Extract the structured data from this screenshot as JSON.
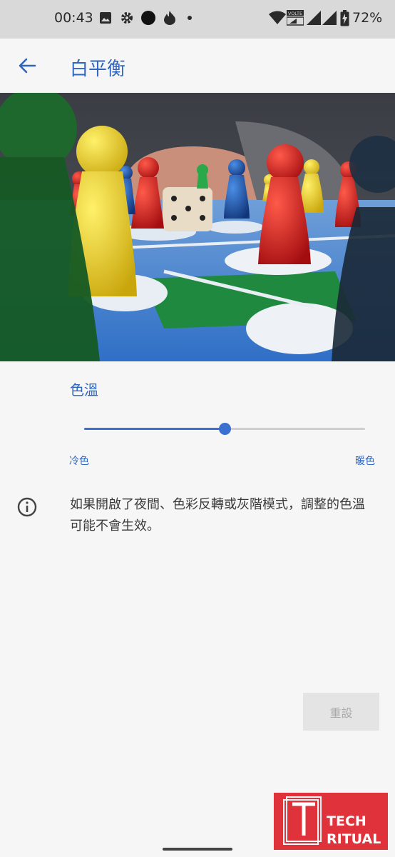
{
  "status_bar": {
    "time": "00:43",
    "battery": "72%",
    "volte_label": "VOLTE",
    "icons": [
      "image-icon",
      "gear-icon",
      "circle-icon",
      "flame-icon",
      "dot-icon",
      "wifi-icon",
      "volte-icon",
      "signal-icon",
      "signal-icon",
      "battery-charging-icon"
    ]
  },
  "app_bar": {
    "title": "白平衡",
    "back_icon": "arrow-back-icon"
  },
  "colors": {
    "accent": "#2f66c0",
    "slider": "#3b6fd0",
    "watermark_bg": "#e0323a"
  },
  "color_temperature": {
    "title": "色溫",
    "cool_label": "冷色",
    "warm_label": "暖色",
    "value_fraction": 0.5
  },
  "info": {
    "icon": "info-icon",
    "text": "如果開啟了夜間、色彩反轉或灰階模式，調整的色溫可能不會生效。"
  },
  "reset_button": {
    "label": "重設"
  },
  "watermark": {
    "line1": "TECH",
    "line2": "RITUAL"
  }
}
